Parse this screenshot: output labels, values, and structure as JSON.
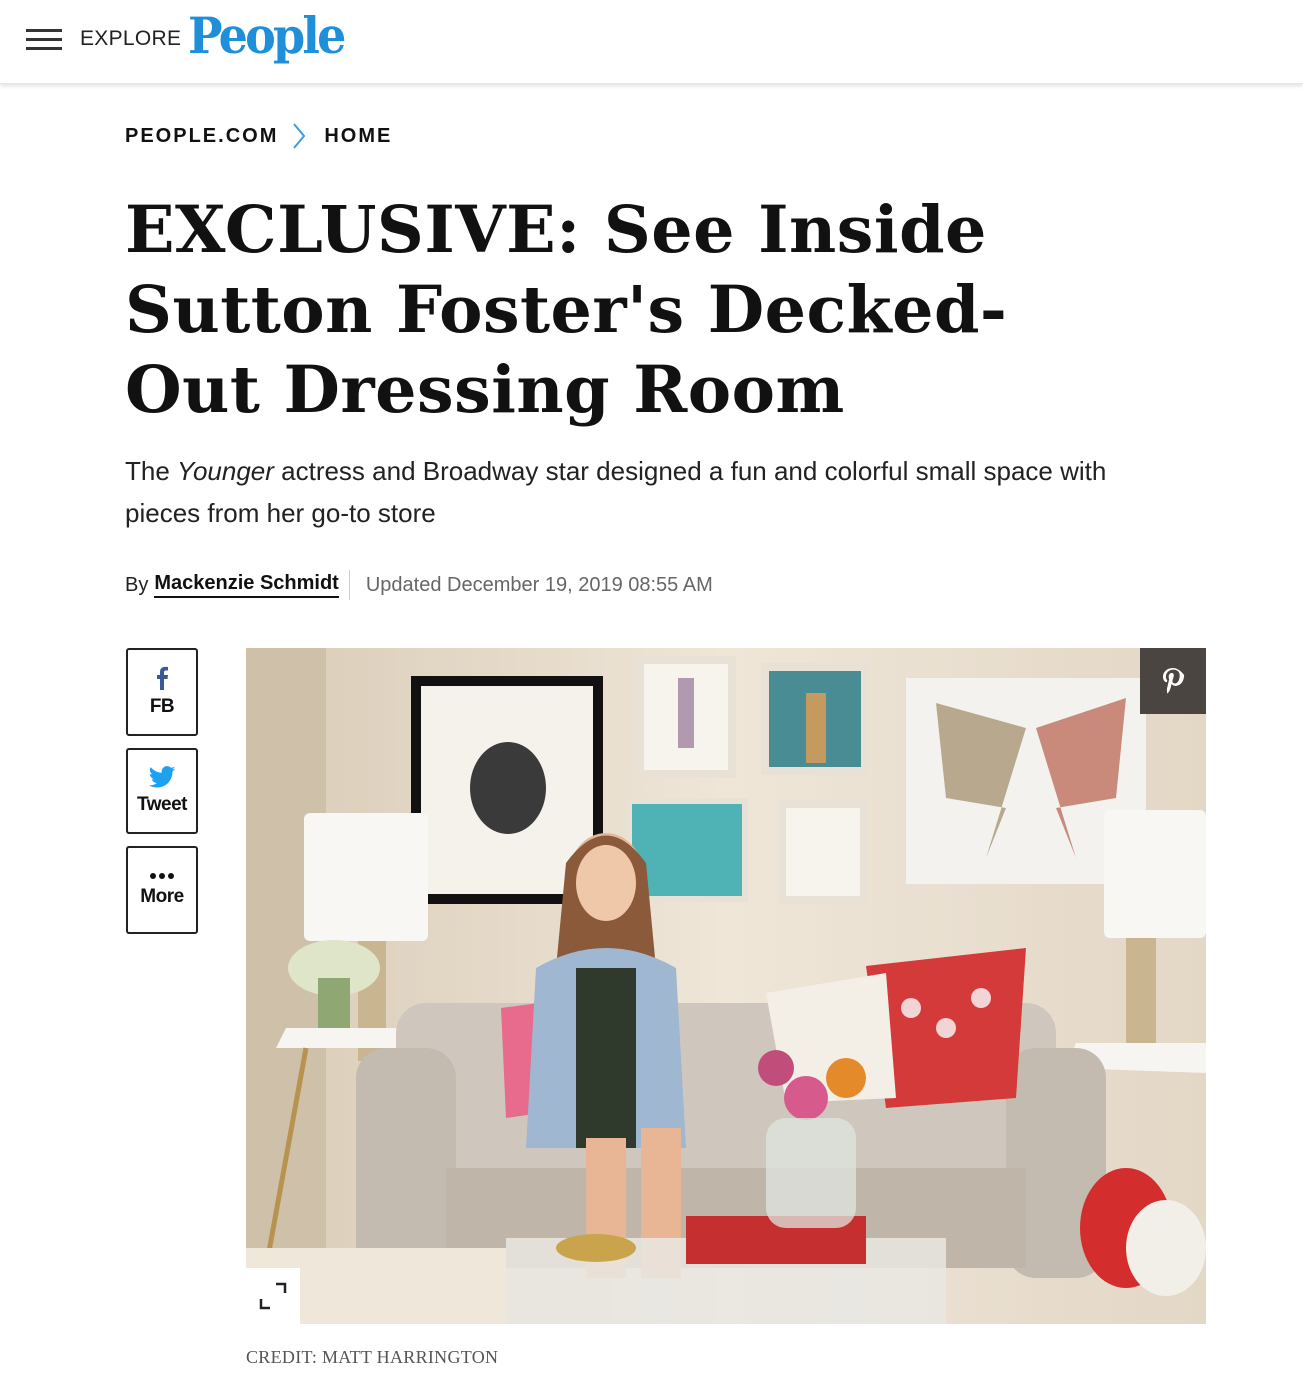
{
  "header": {
    "menu_icon": "hamburger-icon",
    "explore_label": "EXPLORE",
    "logo_text": "People",
    "brand_color": "#1e8fd8"
  },
  "breadcrumb": {
    "items": [
      "PEOPLE.COM",
      "HOME"
    ],
    "separator_icon": "chevron-right-icon",
    "separator_color": "#3aa0dc"
  },
  "article": {
    "title": "EXCLUSIVE: See Inside Sutton Foster's Decked-Out Dressing Room",
    "dek_prefix": "The ",
    "dek_italic": "Younger",
    "dek_suffix": " actress and Broadway star designed a fun and colorful small space with pieces from her go-to store",
    "byline_prefix": "By",
    "author": "Mackenzie Schmidt",
    "updated": "Updated December 19, 2019 08:55 AM"
  },
  "share": {
    "facebook": {
      "label": "FB",
      "icon": "facebook-icon",
      "color": "#3b5998"
    },
    "twitter": {
      "label": "Tweet",
      "icon": "twitter-icon",
      "color": "#1da1f2"
    },
    "more": {
      "label": "More",
      "icon": "more-dots-icon"
    }
  },
  "hero": {
    "pin_icon": "pinterest-icon",
    "expand_icon": "expand-icon",
    "credit": "CREDIT: MATT HARRINGTON"
  }
}
